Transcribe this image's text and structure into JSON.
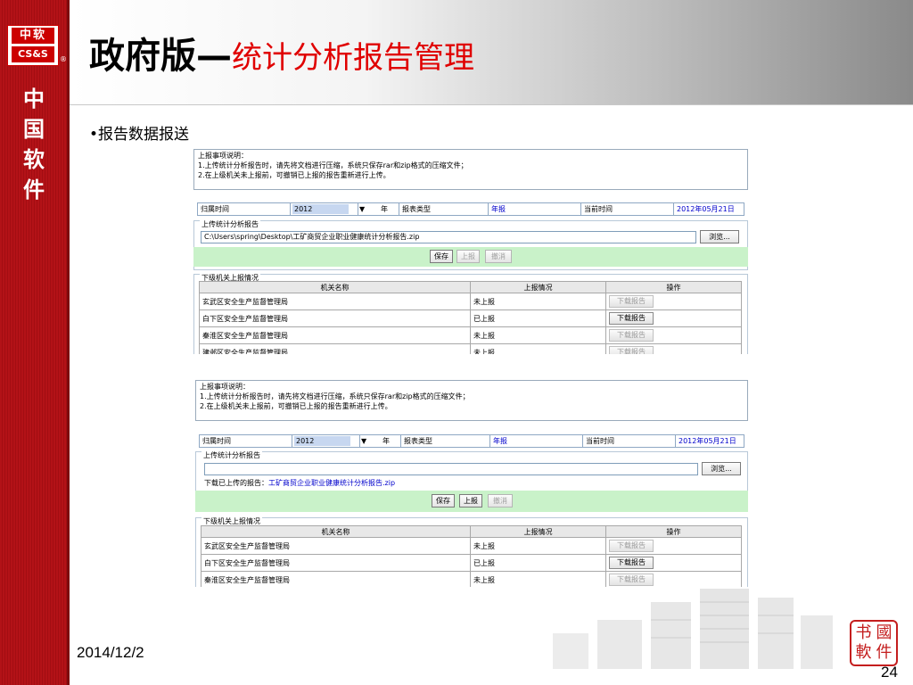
{
  "sidebar": {
    "logo_top": "中软",
    "logo_bottom": "CS&S",
    "logo_mark": "®",
    "vertical_text": "中国软件"
  },
  "slide": {
    "title_main": "政府版—",
    "title_sub": "统计分析报告管理",
    "bullet": "•报告数据报送",
    "date": "2014/12/2",
    "page": "24"
  },
  "seal": {
    "chars": [
      "书",
      "國",
      "軟",
      "件"
    ]
  },
  "panel1": {
    "notice_title": "上报事项说明：",
    "notice_line1": "1.上传统计分析报告时，请先将文档进行压缩，系统只保存rar和zip格式的压缩文件；",
    "notice_line2": "2.在上级机关未上报前，可撤销已上报的报告重新进行上传。",
    "period_label": "归属时间",
    "year_value": "2012",
    "dropdown_arrow": "▼",
    "year_unit": "年",
    "report_type_label": "报表类型",
    "report_type_value": "年报",
    "current_time_label": "当前时间",
    "current_time_value": "2012年05月21日",
    "upload_title": "上传统计分析报告",
    "file_path": "C:\\Users\\spring\\Desktop\\工矿商贸企业职业健康统计分析报告.zip",
    "browse": "浏览...",
    "save": "保存",
    "submit": "上报",
    "revoke": "撤消",
    "sub_title": "下级机关上报情况",
    "table_headers": [
      "机关名称",
      "上报情况",
      "操作"
    ],
    "rows": [
      {
        "name": "玄武区安全生产监督管理局",
        "status": "未上报",
        "action": "下载报告"
      },
      {
        "name": "白下区安全生产监督管理局",
        "status": "已上报",
        "action": "下载报告"
      },
      {
        "name": "秦淮区安全生产监督管理局",
        "status": "未上报",
        "action": "下载报告"
      },
      {
        "name": "建邺区安全生产监督管理局",
        "status": "未上报",
        "action": "下载报告"
      }
    ]
  },
  "panel2": {
    "notice_title": "上报事项说明：",
    "notice_line1": "1.上传统计分析报告时，请先将文档进行压缩，系统只保存rar和zip格式的压缩文件；",
    "notice_line2": "2.在上级机关未上报前，可撤销已上报的报告重新进行上传。",
    "period_label": "归属时间",
    "year_value": "2012",
    "dropdown_arrow": "▼",
    "year_unit": "年",
    "report_type_label": "报表类型",
    "report_type_value": "年报",
    "current_time_label": "当前时间",
    "current_time_value": "2012年05月21日",
    "upload_title": "上传统计分析报告",
    "file_path": "",
    "browse": "浏览...",
    "downloaded_label": "下载已上传的报告：",
    "downloaded_file": "工矿商贸企业职业健康统计分析报告.zip",
    "save": "保存",
    "submit": "上报",
    "revoke": "撤消",
    "sub_title": "下级机关上报情况",
    "table_headers": [
      "机关名称",
      "上报情况",
      "操作"
    ],
    "rows": [
      {
        "name": "玄武区安全生产监督管理局",
        "status": "未上报",
        "action": "下载报告"
      },
      {
        "name": "白下区安全生产监督管理局",
        "status": "已上报",
        "action": "下载报告"
      },
      {
        "name": "秦淮区安全生产监督管理局",
        "status": "未上报",
        "action": "下载报告"
      }
    ]
  }
}
